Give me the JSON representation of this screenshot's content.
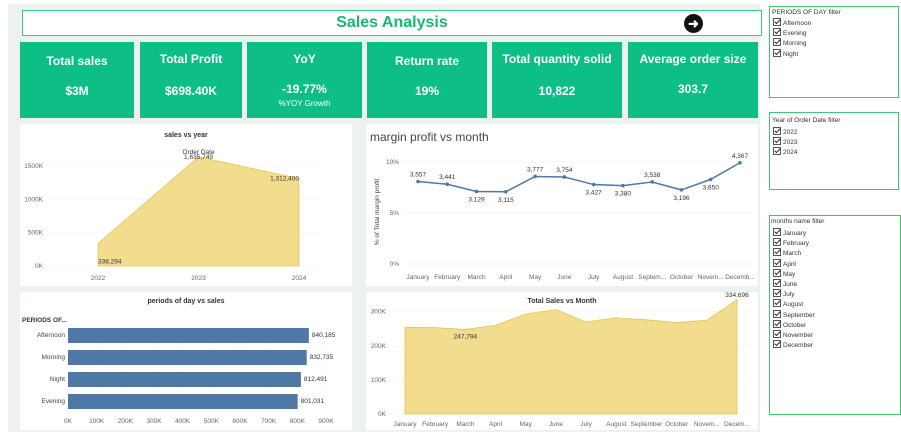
{
  "header": {
    "title": "Sales Analysis",
    "action_icon": "arrow-right-circle-icon"
  },
  "colors": {
    "kpi_bg": "#0dbf86",
    "title_green": "#18b86f",
    "area_fill": "#f2dc8e",
    "bar_fill": "#4e79a7",
    "line_color": "#4e79a7",
    "filter_border": "#3cc96f"
  },
  "kpis": [
    {
      "label": "Total sales",
      "value": "$3M"
    },
    {
      "label": "Total Profit",
      "value": "$698.40K"
    },
    {
      "label": "YoY",
      "value": "-19.77%",
      "sub": "%YOY Growth"
    },
    {
      "label": "Return rate",
      "value": "19%"
    },
    {
      "label": "Total quantity solid",
      "value": "10,822"
    },
    {
      "label": "Average order size",
      "value": "303.7"
    }
  ],
  "panels": {
    "sales_vs_year": "sales vs year",
    "margin_vs_month": "margin profit vs month",
    "periods_vs_sales": "periods of day vs sales",
    "total_vs_month": "Total Sales vs Month"
  },
  "chart_data": [
    {
      "type": "area",
      "title": "sales vs year",
      "annotation": "Order Date",
      "categories": [
        "2022",
        "2023",
        "2024"
      ],
      "values": [
        338294,
        1635749,
        1312400
      ],
      "value_labels": [
        "338,294",
        "1,635,749",
        "1,312,400"
      ],
      "y_ticks": [
        "0K",
        "500K",
        "1000K",
        "1500K"
      ],
      "ylim": [
        0,
        1800000
      ]
    },
    {
      "type": "line",
      "title": "margin profit vs month",
      "ylabel": "% of Total margin profit",
      "categories": [
        "January",
        "February",
        "March",
        "April",
        "May",
        "June",
        "July",
        "August",
        "Septem...",
        "October",
        "Novem...",
        "Decemb..."
      ],
      "values": [
        3557,
        3441,
        3129,
        3115,
        3777,
        3754,
        3427,
        3380,
        3538,
        3196,
        3650,
        4367
      ],
      "value_labels": [
        "3,557",
        "3,441",
        "3,129",
        "3,115",
        "3,777",
        "3,754",
        "3,427",
        "3,380",
        "3,538",
        "3,196",
        "3,650",
        "4,367"
      ],
      "y_ticks": [
        "0%",
        "5%",
        "10%"
      ],
      "ylim": [
        0,
        4400
      ]
    },
    {
      "type": "bar",
      "title": "periods of day vs sales",
      "orientation": "horizontal",
      "axis_label": "PERIODS OF...",
      "categories": [
        "Afternoon",
        "Morning",
        "Night",
        "Evening"
      ],
      "values": [
        840185,
        832735,
        812491,
        801031
      ],
      "value_labels": [
        "840,185",
        "832,735",
        "812,491",
        "801,031"
      ],
      "x_ticks": [
        "0K",
        "100K",
        "200K",
        "300K",
        "400K",
        "500K",
        "600K",
        "700K",
        "800K",
        "900K"
      ],
      "xlim": [
        0,
        900000
      ]
    },
    {
      "type": "area",
      "title": "Total Sales vs Month",
      "categories": [
        "January",
        "February",
        "March",
        "April",
        "May",
        "June",
        "July",
        "August",
        "September",
        "October",
        "Novem...",
        "Decem..."
      ],
      "values": [
        254000,
        253000,
        247794,
        260000,
        293000,
        306000,
        270000,
        282000,
        276000,
        268000,
        275000,
        334696
      ],
      "labeled": {
        "2": "247,794",
        "11": "334,696"
      },
      "y_ticks": [
        "0K",
        "100K",
        "200K",
        "300K"
      ],
      "ylim": [
        0,
        340000
      ]
    }
  ],
  "filters": {
    "periods": {
      "title": "PERIODS OF DAY filter",
      "items": [
        "Afternoon",
        "Evening",
        "Morning",
        "Night"
      ]
    },
    "years": {
      "title": "Year of Order Date filter",
      "items": [
        "2022",
        "2023",
        "2024"
      ]
    },
    "months": {
      "title": "months name filter",
      "items": [
        "January",
        "February",
        "March",
        "April",
        "May",
        "June",
        "July",
        "August",
        "September",
        "October",
        "November",
        "December"
      ]
    }
  }
}
